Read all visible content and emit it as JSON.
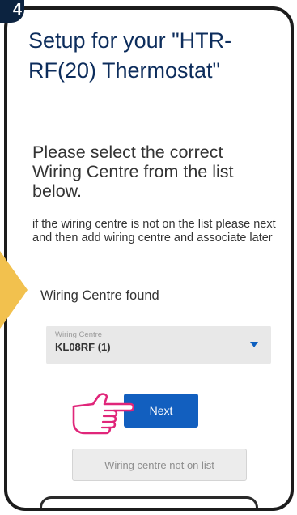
{
  "step_badge": "4",
  "header": {
    "title": "Setup for your \"HTR-RF(20) Thermostat\""
  },
  "prompt": {
    "title": "Please select the correct Wiring Centre from the list below.",
    "helper": "if the wiring centre is not on the list please next and then add wiring centre and associate later"
  },
  "found_label": "Wiring Centre found",
  "select": {
    "caption": "Wiring Centre",
    "value": "KL08RF (1)"
  },
  "buttons": {
    "next": "Next",
    "not_on_list": "Wiring centre not on list"
  },
  "colors": {
    "primary": "#125fbf",
    "title": "#0d2d5c",
    "accent_arrow": "#f2c14e",
    "badge": "#0c2340"
  },
  "icons": [
    "pointing-hand-icon",
    "dropdown-caret-icon"
  ]
}
